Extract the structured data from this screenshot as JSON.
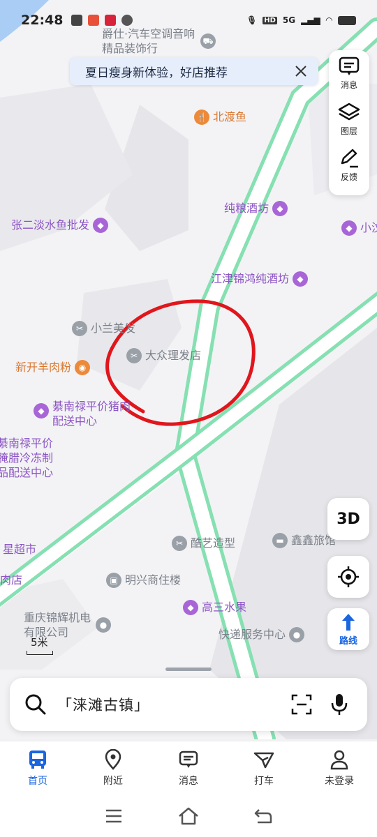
{
  "status_bar": {
    "time": "22:48",
    "network": "5G"
  },
  "banner": {
    "text": "夏日瘦身新体验，好店推荐"
  },
  "tools": [
    {
      "label": "消息",
      "icon": "message-icon"
    },
    {
      "label": "图层",
      "icon": "layers-icon"
    },
    {
      "label": "反馈",
      "icon": "feedback-icon"
    }
  ],
  "map": {
    "pois": [
      {
        "name": "爵仕·汽车空调音响精品装饰行"
      },
      {
        "name": "北渡鱼"
      },
      {
        "name": "纯粮酒坊"
      },
      {
        "name": "张二淡水鱼批发"
      },
      {
        "name": "小汶"
      },
      {
        "name": "江津锦鸿纯酒坊"
      },
      {
        "name": "小兰美发"
      },
      {
        "name": "大众理发店"
      },
      {
        "name": "新开羊肉粉"
      },
      {
        "name": "綦南禄平价猪肉配送中心"
      },
      {
        "name": "綦南禄平价腌腊冷冻制品配送中心"
      },
      {
        "name": "酷艺造型"
      },
      {
        "name": "鑫鑫旅馆"
      },
      {
        "name": "星超市"
      },
      {
        "name": "明兴商住楼"
      },
      {
        "name": "肉店"
      },
      {
        "name": "高三水果"
      },
      {
        "name": "重庆锦辉机电有限公司"
      },
      {
        "name": "快递服务中心"
      }
    ],
    "scale": "5米"
  },
  "buttons": {
    "view_3d": "3D",
    "route": "路线"
  },
  "search": {
    "text": "「涞滩古镇」"
  },
  "tabs": [
    {
      "label": "首页",
      "icon": "bus-icon"
    },
    {
      "label": "附近",
      "icon": "location-pin-icon"
    },
    {
      "label": "消息",
      "icon": "message-icon"
    },
    {
      "label": "打车",
      "icon": "taxi-icon"
    },
    {
      "label": "未登录",
      "icon": "user-icon"
    }
  ],
  "colors": {
    "accent": "#1a66e0",
    "road": "#86e0b2",
    "annotation": "#e0161c",
    "poi_purple": "#8c55c4"
  }
}
